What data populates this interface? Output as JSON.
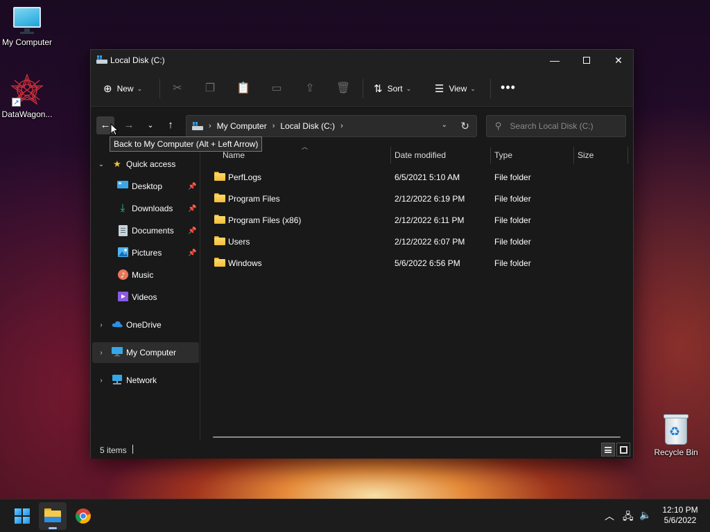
{
  "desktop": {
    "icons": [
      {
        "label": "My Computer"
      },
      {
        "label": "DataWagon..."
      },
      {
        "label": "Recycle Bin"
      }
    ]
  },
  "window": {
    "title": "Local Disk (C:)",
    "toolbar": {
      "new_label": "New",
      "sort_label": "Sort",
      "view_label": "View",
      "more_label": "•••"
    },
    "address": {
      "segments": [
        "My Computer",
        "Local Disk (C:)"
      ]
    },
    "search": {
      "placeholder": "Search Local Disk (C:)"
    },
    "tooltip": "Back to My Computer (Alt + Left Arrow)",
    "sidebar": {
      "quick_access": "Quick access",
      "pinned": [
        {
          "label": "Desktop"
        },
        {
          "label": "Downloads"
        },
        {
          "label": "Documents"
        },
        {
          "label": "Pictures"
        },
        {
          "label": "Music"
        },
        {
          "label": "Videos"
        }
      ],
      "onedrive": "OneDrive",
      "my_computer": "My Computer",
      "network": "Network"
    },
    "columns": {
      "name": "Name",
      "date": "Date modified",
      "type": "Type",
      "size": "Size"
    },
    "files": [
      {
        "name": "PerfLogs",
        "date": "6/5/2021 5:10 AM",
        "type": "File folder"
      },
      {
        "name": "Program Files",
        "date": "2/12/2022 6:19 PM",
        "type": "File folder"
      },
      {
        "name": "Program Files (x86)",
        "date": "2/12/2022 6:11 PM",
        "type": "File folder"
      },
      {
        "name": "Users",
        "date": "2/12/2022 6:07 PM",
        "type": "File folder"
      },
      {
        "name": "Windows",
        "date": "5/6/2022 6:56 PM",
        "type": "File folder"
      }
    ],
    "status": {
      "count": "5 items"
    }
  },
  "taskbar": {
    "time": "12:10 PM",
    "date": "5/6/2022"
  },
  "colors": {
    "window_bg": "#191919",
    "folder": "#f2be3a",
    "accent": "#1a8ee6"
  }
}
